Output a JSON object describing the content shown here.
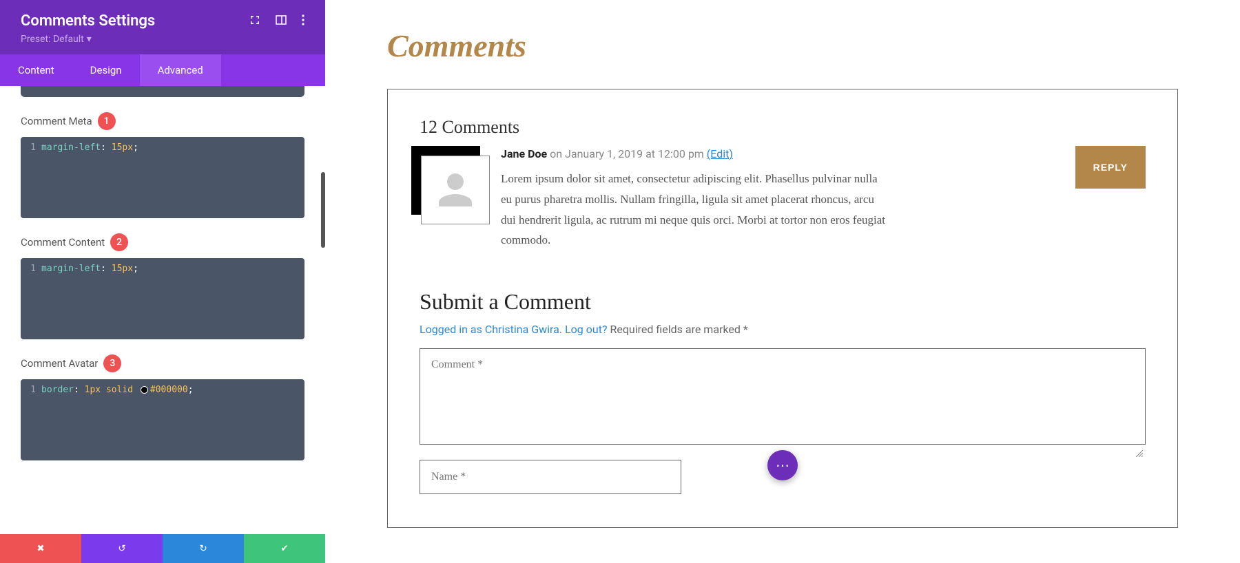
{
  "sidebar": {
    "title": "Comments Settings",
    "preset_label": "Preset: Default",
    "tabs": {
      "content": "Content",
      "design": "Design",
      "advanced": "Advanced"
    },
    "sections": [
      {
        "label": "Comment Meta",
        "badge": "1",
        "line_no": "1",
        "code_html": "<span class='prop'>margin-left</span><span class='punc'>:</span> <span class='val'>15px</span><span class='punc'>;</span>"
      },
      {
        "label": "Comment Content",
        "badge": "2",
        "line_no": "1",
        "code_html": "<span class='prop'>margin-left</span><span class='punc'>:</span> <span class='val'>15px</span><span class='punc'>;</span>"
      },
      {
        "label": "Comment Avatar",
        "badge": "3",
        "line_no": "1",
        "code_html": "<span class='prop'>border</span><span class='punc'>:</span> <span class='val'>1px</span> <span class='val'>solid</span> <span class='color-swatch'></span><span class='val'>#000000</span><span class='punc'>;</span>"
      }
    ]
  },
  "preview": {
    "heading": "Comments",
    "count_label": "12 Comments",
    "comment": {
      "author": "Jane Doe",
      "date": "on January 1, 2019 at 12:00 pm",
      "edit": "(Edit)",
      "body": "Lorem ipsum dolor sit amet, consectetur adipiscing elit. Phasellus pulvinar nulla eu purus pharetra mollis. Nullam fringilla, ligula sit amet placerat rhoncus, arcu dui hendrerit ligula, ac rutrum mi neque quis orci. Morbi at tortor non eros feugiat commodo.",
      "reply": "REPLY"
    },
    "form": {
      "heading": "Submit a Comment",
      "logged_in": "Logged in as Christina Gwira",
      "logout": "Log out?",
      "required": "Required fields are marked *",
      "comment_label": "Comment *",
      "name_label": "Name *"
    }
  }
}
